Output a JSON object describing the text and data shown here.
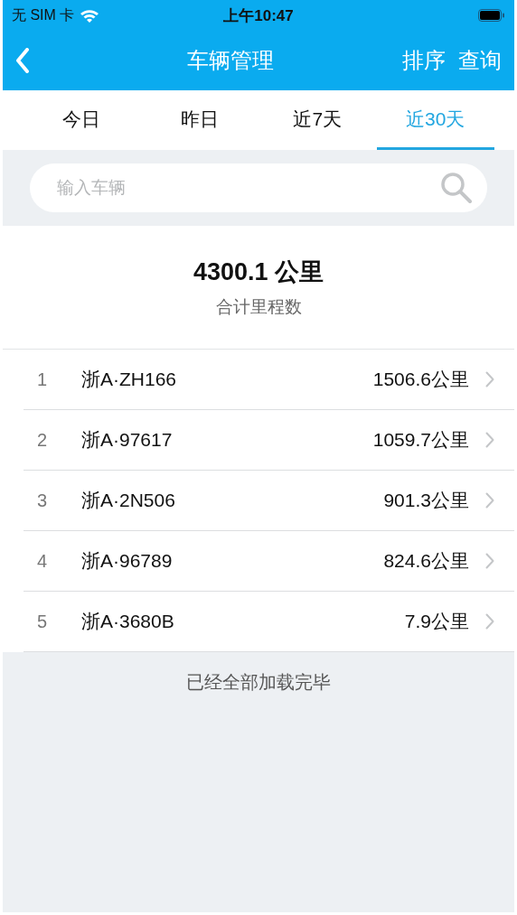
{
  "status_bar": {
    "carrier": "无 SIM 卡",
    "time": "上午10:47"
  },
  "nav": {
    "title": "车辆管理",
    "actions": [
      "排序",
      "查询"
    ]
  },
  "tabs": [
    {
      "label": "今日",
      "selected": false
    },
    {
      "label": "昨日",
      "selected": false
    },
    {
      "label": "近7天",
      "selected": false
    },
    {
      "label": "近30天",
      "selected": true
    }
  ],
  "search": {
    "placeholder": "输入车辆"
  },
  "summary": {
    "value": "4300.1 公里",
    "label": "合计里程数"
  },
  "vehicles": [
    {
      "rank": "1",
      "plate": "浙A·ZH166",
      "distance": "1506.6公里"
    },
    {
      "rank": "2",
      "plate": "浙A·97617",
      "distance": "1059.7公里"
    },
    {
      "rank": "3",
      "plate": "浙A·2N506",
      "distance": "901.3公里"
    },
    {
      "rank": "4",
      "plate": "浙A·96789",
      "distance": "824.6公里"
    },
    {
      "rank": "5",
      "plate": "浙A·3680B",
      "distance": "7.9公里"
    }
  ],
  "footer": "已经全部加载完毕"
}
